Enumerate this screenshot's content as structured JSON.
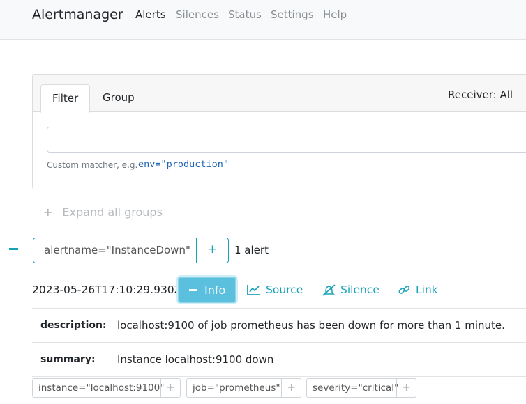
{
  "navbar": {
    "brand": "Alertmanager",
    "links": [
      "Alerts",
      "Silences",
      "Status",
      "Settings",
      "Help"
    ],
    "active": "Alerts"
  },
  "filter_card": {
    "tabs": [
      "Filter",
      "Group"
    ],
    "active_tab": "Filter",
    "receiver": "Receiver: All",
    "input_value": "",
    "hint_label": "Custom matcher, e.g.",
    "hint_example": "env=\"production\""
  },
  "expand_all": {
    "icon": "+",
    "label": "Expand all groups"
  },
  "group": {
    "collapse_icon": "minus-icon",
    "label": "alertname=\"InstanceDown\"",
    "add_icon": "+",
    "count": "1 alert"
  },
  "alert": {
    "timestamp": "2023-05-26T17:10:29.930Z",
    "info_label": "Info",
    "actions": {
      "source": "Source",
      "silence": "Silence",
      "link": "Link"
    },
    "annotations": [
      {
        "key": "description:",
        "value": "localhost:9100 of job prometheus has been down for more than 1 minute."
      },
      {
        "key": "summary:",
        "value": "Instance localhost:9100 down"
      }
    ],
    "labels": [
      "instance=\"localhost:9100\"",
      "job=\"prometheus\"",
      "severity=\"critical\""
    ],
    "label_add_icon": "+"
  },
  "colors": {
    "accent": "#17a2b8",
    "info": "#5bc0de",
    "muted": "#8a8f94"
  }
}
